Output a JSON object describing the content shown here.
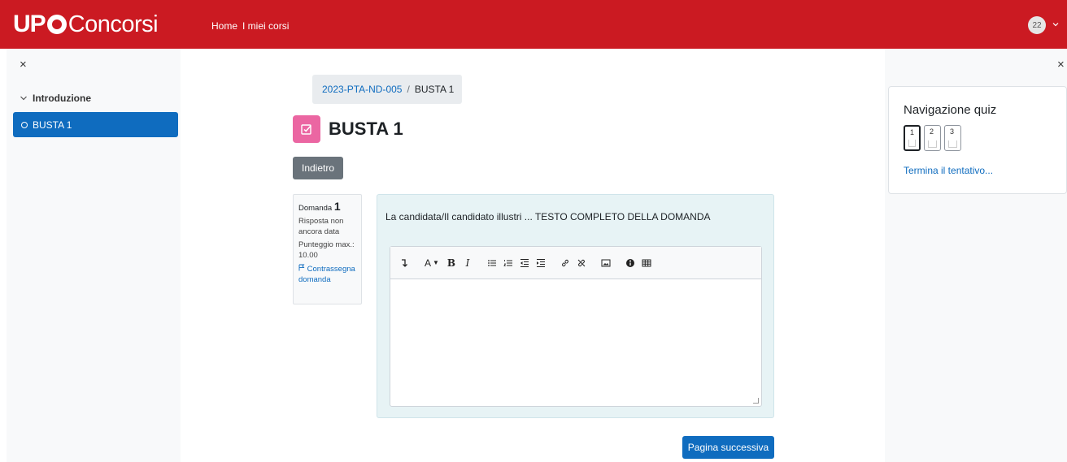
{
  "header": {
    "logo_up": "UP",
    "logo_concorsi": "Concorsi",
    "nav": [
      {
        "label": "Home"
      },
      {
        "label": "I miei corsi"
      }
    ],
    "user_avatar": "22"
  },
  "course_index": {
    "close_label": "×",
    "section_title": "Introduzione",
    "items": [
      {
        "label": "BUSTA 1",
        "active": true
      }
    ]
  },
  "breadcrumb": {
    "course": "2023-PTA-ND-005",
    "separator": "/",
    "current": "BUSTA 1"
  },
  "page": {
    "title": "BUSTA 1",
    "back_button": "Indietro",
    "next_button": "Pagina successiva",
    "accent_color": "#0f6cbf",
    "quiz_icon_color": "#eb66a2"
  },
  "question": {
    "label": "Domanda",
    "number": "1",
    "status": "Risposta non ancora data",
    "max_score_label": "Punteggio max.:",
    "max_score": "10.00",
    "flag_label": "Contrassegna domanda",
    "text": "La candidata/Il candidato illustri ... TESTO COMPLETO DELLA DOMANDA"
  },
  "editor": {
    "toolbar_icons": [
      "arrow-down-icon",
      "font-color-icon",
      "bold-icon",
      "italic-icon",
      "unordered-list-icon",
      "ordered-list-icon",
      "outdent-icon",
      "indent-icon",
      "link-icon",
      "unlink-icon",
      "image-icon",
      "accessibility-icon",
      "table-icon"
    ]
  },
  "quiz_navigation": {
    "close_label": "×",
    "title": "Navigazione quiz",
    "questions": [
      "1",
      "2",
      "3"
    ],
    "current": "1",
    "finish_link": "Termina il tentativo..."
  }
}
